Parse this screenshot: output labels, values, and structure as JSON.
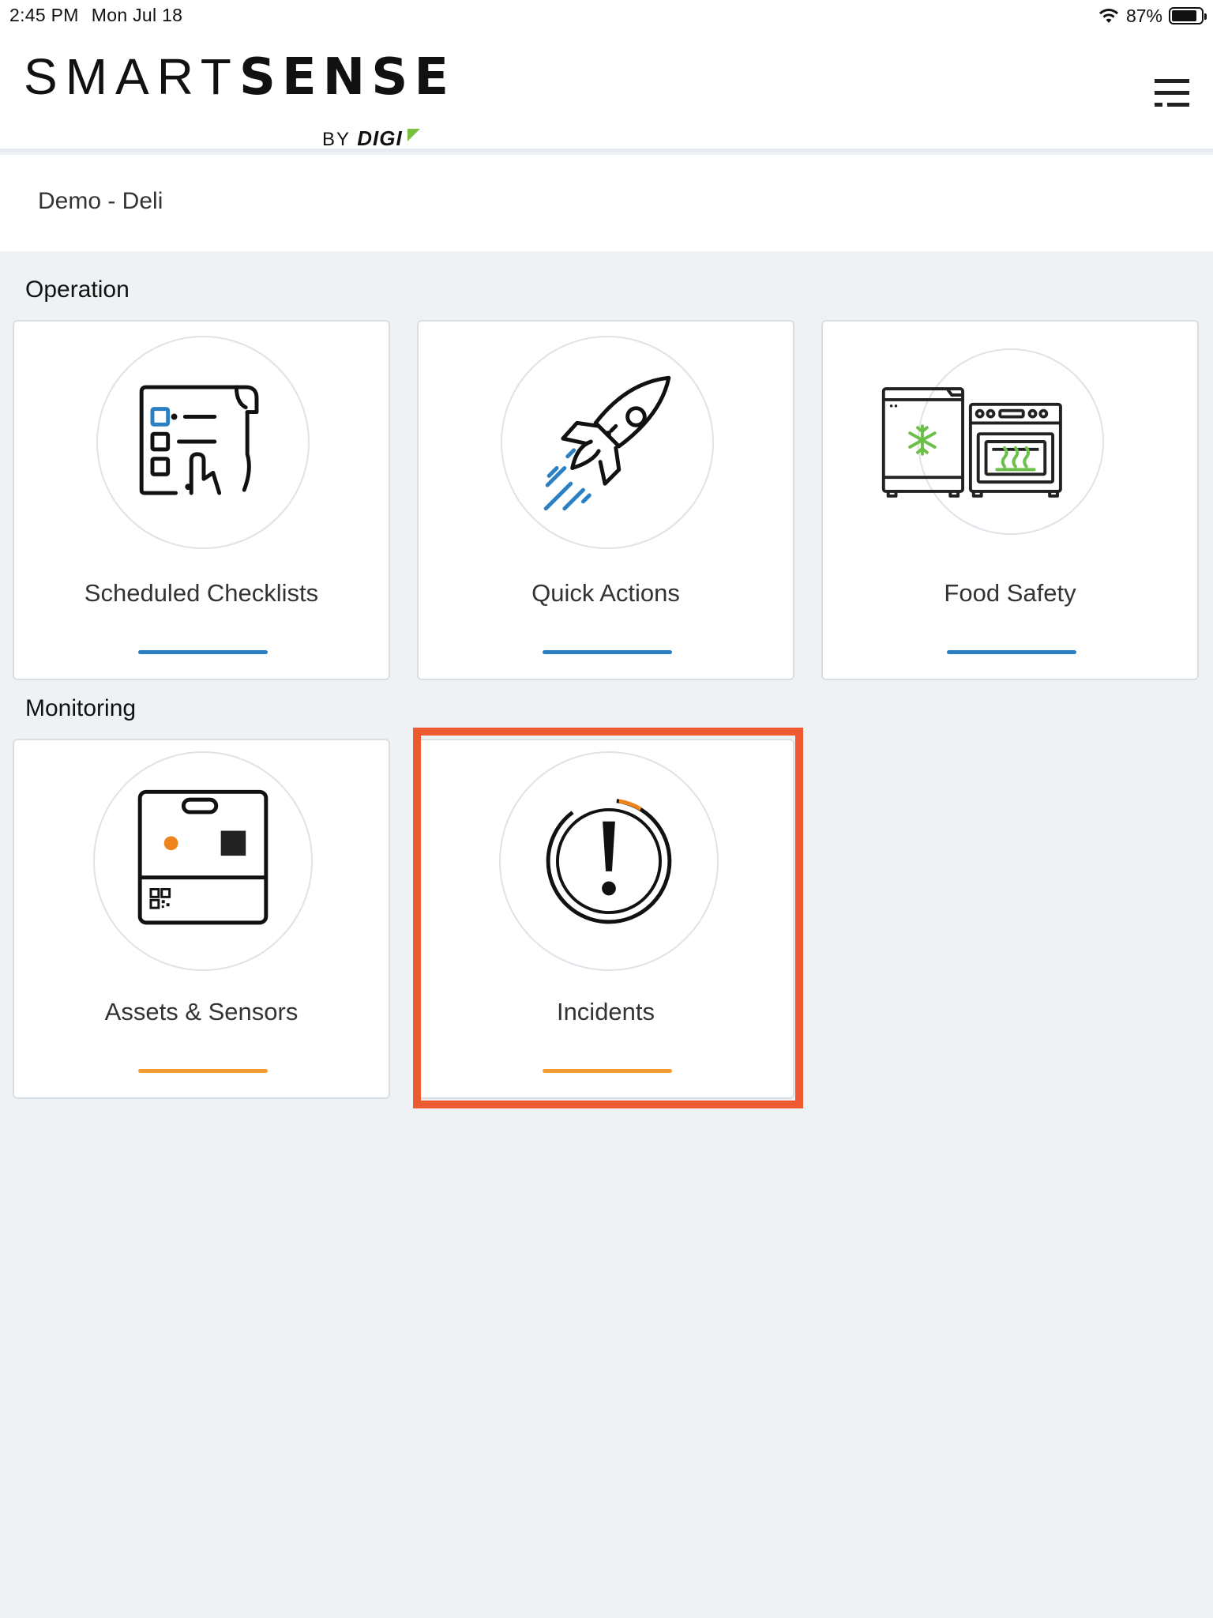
{
  "status_bar": {
    "time": "2:45 PM",
    "date": "Mon Jul 18",
    "battery": "87%",
    "battery_level": 0.87
  },
  "header": {
    "logo_smart": "SMART",
    "logo_sense": "SENSE",
    "logo_by": "BY",
    "logo_digi": "DIGI",
    "menu_icon": "hamburger-menu-icon"
  },
  "location": {
    "name": "Demo - Deli"
  },
  "sections": {
    "operation": {
      "title": "Operation",
      "tiles": [
        {
          "label": "Scheduled Checklists",
          "icon": "checklist-icon",
          "accent": "#2b7fc3"
        },
        {
          "label": "Quick Actions",
          "icon": "rocket-icon",
          "accent": "#2b7fc3"
        },
        {
          "label": "Food Safety",
          "icon": "fridge-oven-icon",
          "accent": "#2b7fc3"
        }
      ]
    },
    "monitoring": {
      "title": "Monitoring",
      "tiles": [
        {
          "label": "Assets & Sensors",
          "icon": "sensor-device-icon",
          "accent": "#f39c34"
        },
        {
          "label": "Incidents",
          "icon": "alert-icon",
          "accent": "#f39c34"
        }
      ]
    }
  },
  "colors": {
    "operation_accent": "#2b7fc3",
    "monitoring_accent": "#f39c34",
    "highlight": "#ee5a2f",
    "logo_green": "#7ac143",
    "background": "#eff2f5"
  }
}
